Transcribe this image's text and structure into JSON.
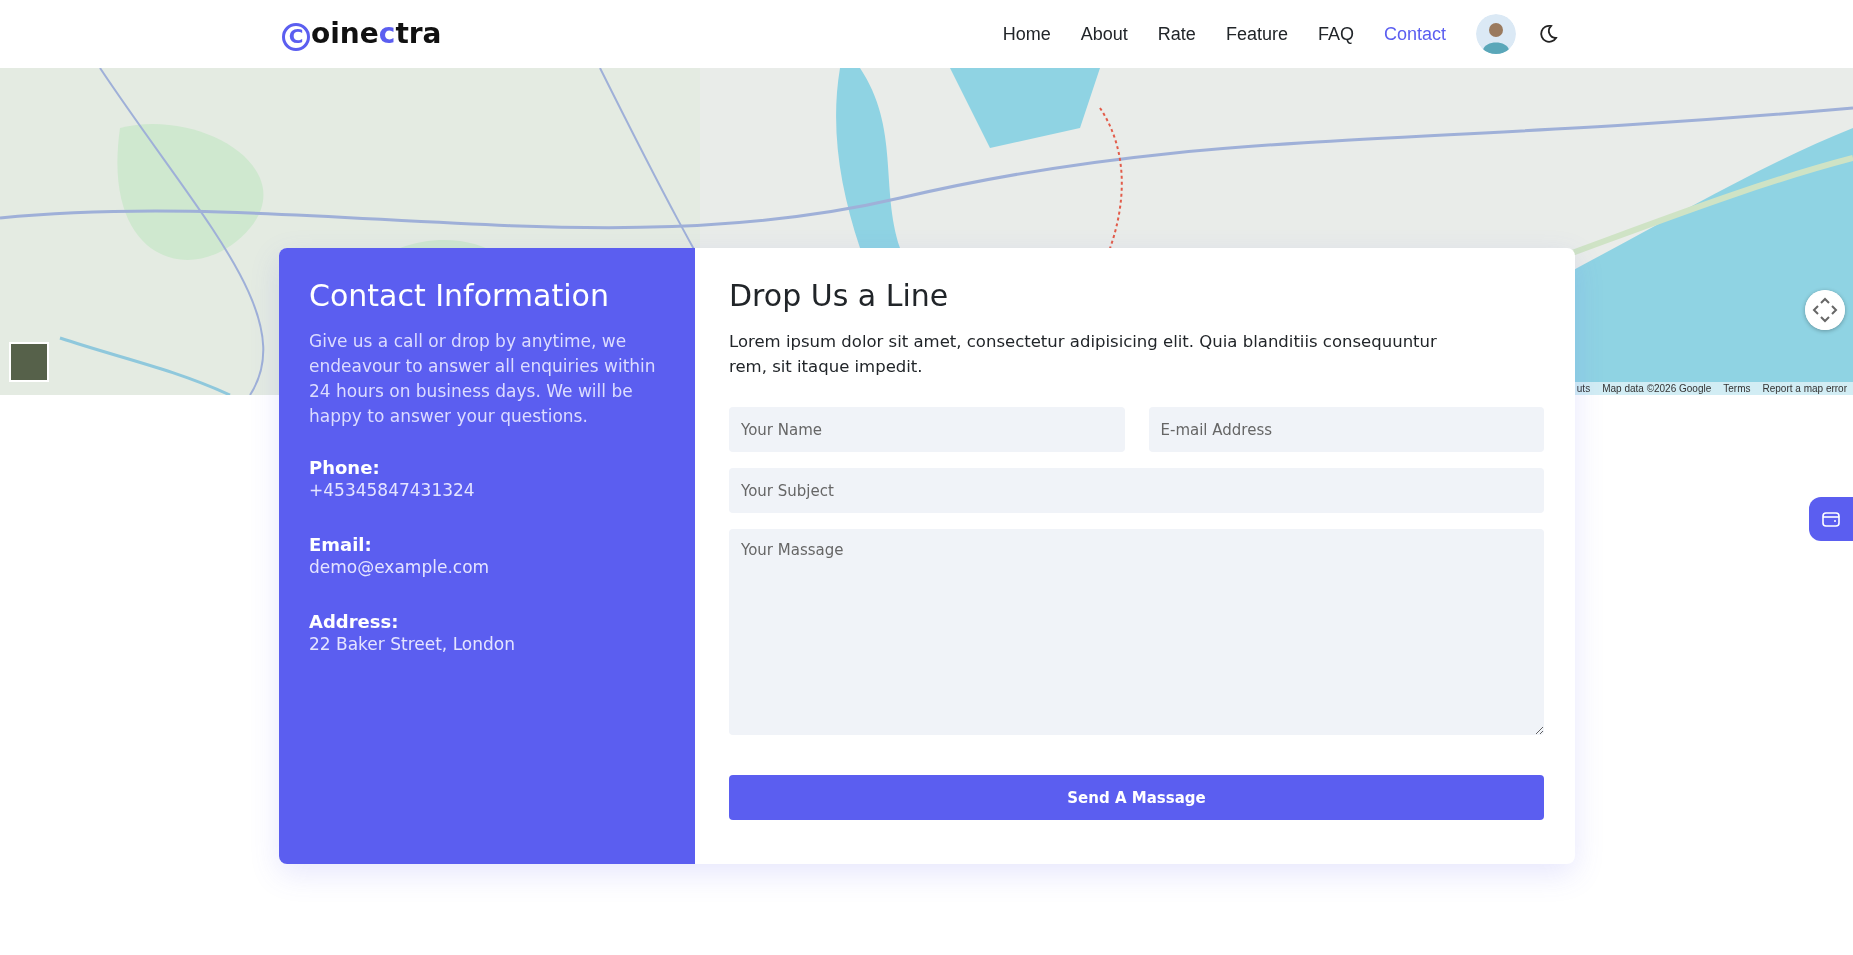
{
  "header": {
    "logo": [
      {
        "text": "C",
        "accent": true
      },
      {
        "text": "oine",
        "accent": false
      },
      {
        "text": "c",
        "accent": true
      },
      {
        "text": "tra",
        "accent": false
      }
    ],
    "nav": [
      {
        "label": "Home",
        "selected": false
      },
      {
        "label": "About",
        "selected": false
      },
      {
        "label": "Rate",
        "selected": false
      },
      {
        "label": "Feature",
        "selected": false
      },
      {
        "label": "FAQ",
        "selected": false
      },
      {
        "label": "Contact",
        "selected": true
      }
    ]
  },
  "map": {
    "attribution": [
      "uts",
      "Map data ©2026 Google",
      "Terms",
      "Report a map error"
    ]
  },
  "contact_info": {
    "title": "Contact Information",
    "intro": "Give us a call or drop by anytime, we endeavour to answer all enquiries within 24 hours on business days. We will be happy to answer your questions.",
    "items": [
      {
        "label": "Phone:",
        "value": "+45345847431324"
      },
      {
        "label": "Email:",
        "value": "demo@example.com"
      },
      {
        "label": "Address:",
        "value": "22 Baker Street, London"
      }
    ]
  },
  "form": {
    "title": "Drop Us a Line",
    "intro": "Lorem ipsum dolor sit amet, consectetur adipisicing elit. Quia blanditiis consequuntur rem, sit itaque impedit.",
    "name": {
      "placeholder": "Your Name"
    },
    "email": {
      "placeholder": "E-mail Address"
    },
    "subject": {
      "placeholder": "Your Subject"
    },
    "message": {
      "placeholder": "Your Massage"
    },
    "submit": "Send A Massage"
  }
}
